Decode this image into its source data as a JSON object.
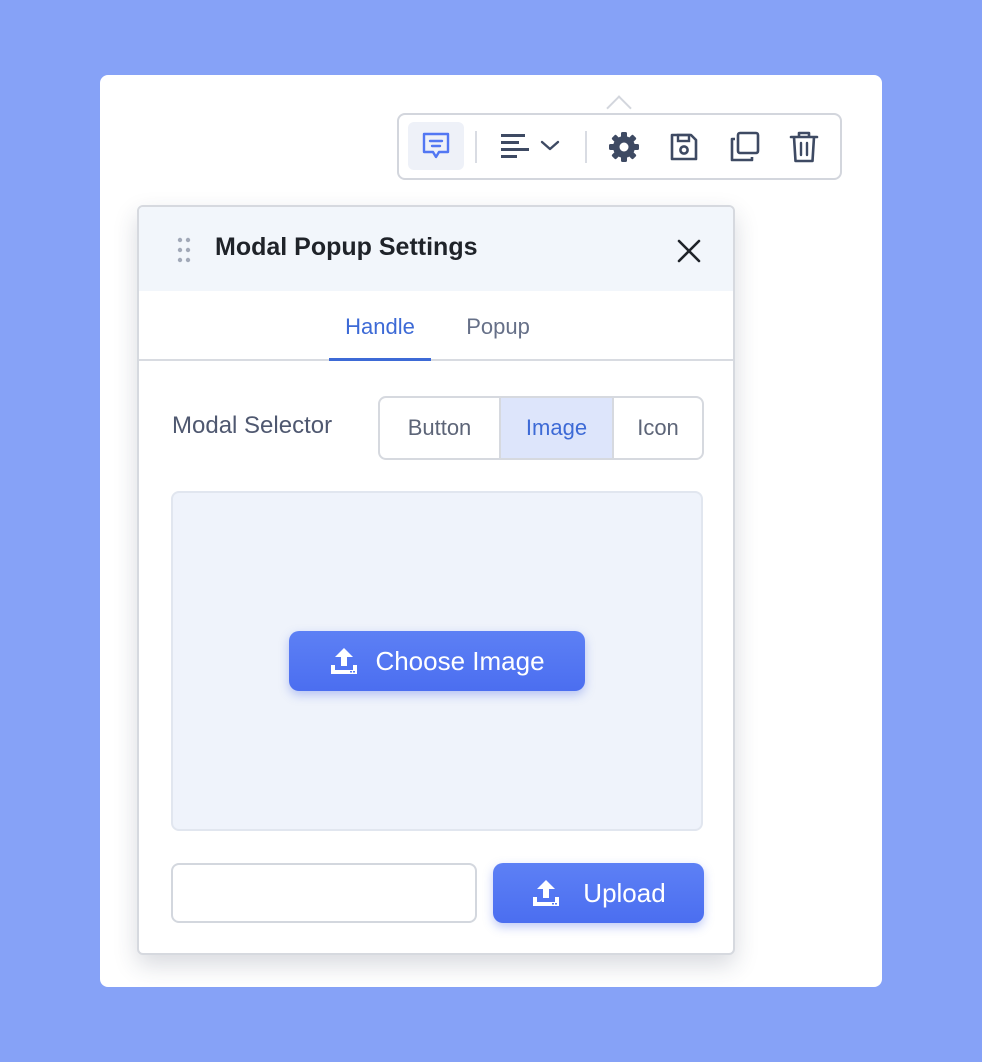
{
  "toolbar": {
    "icons": {
      "popup": "message-square-icon",
      "align": "align-left-icon",
      "align_dropdown": "chevron-down-icon",
      "settings": "gear-icon",
      "save": "save-icon",
      "duplicate": "copy-icon",
      "delete": "trash-icon"
    }
  },
  "modal": {
    "title": "Modal Popup Settings",
    "tabs": [
      {
        "label": "Handle",
        "active": true
      },
      {
        "label": "Popup",
        "active": false
      }
    ],
    "selector": {
      "label": "Modal Selector",
      "options": [
        "Button",
        "Image",
        "Icon"
      ],
      "selected": "Image"
    },
    "choose_image_label": "Choose Image",
    "url_input": {
      "value": "",
      "placeholder": ""
    },
    "upload_label": "Upload"
  },
  "colors": {
    "background": "#86a2f7",
    "accent": "#3d6ad6",
    "button": "#5277f3",
    "selected_segment": "#dde5fb",
    "dropzone": "#eff3fb"
  }
}
